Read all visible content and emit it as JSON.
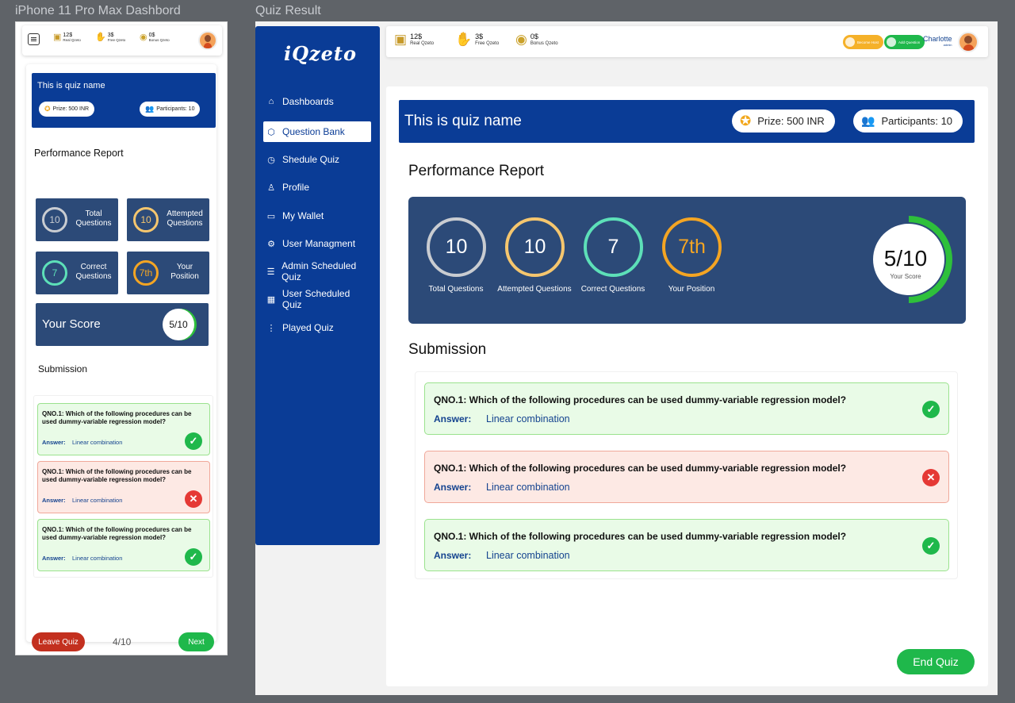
{
  "frames": {
    "mobile_label": "iPhone 11 Pro Max  Dashbord",
    "desktop_label": "Quiz Result"
  },
  "wallet": [
    {
      "amount": "12$",
      "label": "Real Qzeto",
      "icon": "wallet-icon"
    },
    {
      "amount": "3$",
      "label": "Free Qzeto",
      "icon": "free-coins-icon"
    },
    {
      "amount": "0$",
      "label": "Bonus Qzeto",
      "icon": "bonus-coins-icon"
    }
  ],
  "app": {
    "logo": "iQzeto"
  },
  "nav": [
    {
      "label": "Dashboards",
      "icon": "home-icon",
      "glyph": "⌂",
      "active": false
    },
    {
      "label": "Question Bank",
      "icon": "cube-icon",
      "glyph": "⬡",
      "active": true
    },
    {
      "label": "Shedule Quiz",
      "icon": "clock-icon",
      "glyph": "◷",
      "active": false
    },
    {
      "label": "Profile",
      "icon": "user-icon",
      "glyph": "♙",
      "active": false
    },
    {
      "label": "My Wallet",
      "icon": "wallet-icon",
      "glyph": "▭",
      "active": false
    },
    {
      "label": "User Managment",
      "icon": "user-gear-icon",
      "glyph": "⚙",
      "active": false
    },
    {
      "label": "Admin Scheduled Quiz",
      "icon": "doc-icon",
      "glyph": "☰",
      "active": false
    },
    {
      "label": "User Scheduled Quiz",
      "icon": "calendar-icon",
      "glyph": "▦",
      "active": false
    },
    {
      "label": "Played Quiz",
      "icon": "list-icon",
      "glyph": "⋮",
      "active": false
    }
  ],
  "user": {
    "name": "Charlotte",
    "role": "admin"
  },
  "top_actions": [
    "Become Host",
    "Add Question"
  ],
  "quiz": {
    "name": "This is quiz name",
    "prize": "Prize: 500 INR",
    "participants": "Participants: 10"
  },
  "performance": {
    "title": "Performance Report",
    "stats": [
      {
        "value": "10",
        "label": "Total Questions",
        "color": "#c9ccd1"
      },
      {
        "value": "10",
        "label": "Attempted Questions",
        "color": "#f5c66e"
      },
      {
        "value": "7",
        "label": "Correct Questions",
        "color": "#5de0b8"
      },
      {
        "value": "7th",
        "label": "Your Position",
        "color": "#f4a523"
      }
    ],
    "score": {
      "value": "5/10",
      "label": "Your Score",
      "mobile_label": "Your Score",
      "fraction": 0.5
    }
  },
  "submission": {
    "title": "Submission",
    "answer_label": "Answer:",
    "items": [
      {
        "question": "QNO.1:  Which of the following procedures can be used  dummy-variable regression model?",
        "answer": "Linear combination",
        "correct": true
      },
      {
        "question": "QNO.1:  Which of the following procedures can be used  dummy-variable regression model?",
        "answer": "Linear combination",
        "correct": false
      },
      {
        "question": "QNO.1:  Which of the following procedures can be used  dummy-variable regression model?",
        "answer": "Linear combination",
        "correct": true
      }
    ]
  },
  "mobile_footer": {
    "leave": "Leave Quiz",
    "progress": "4/10",
    "next": "Next"
  },
  "end_quiz": "End Quiz",
  "colors": {
    "brand": "#0a3c96",
    "panel": "#2c4a78",
    "success": "#1fb84b",
    "danger": "#e53935"
  }
}
